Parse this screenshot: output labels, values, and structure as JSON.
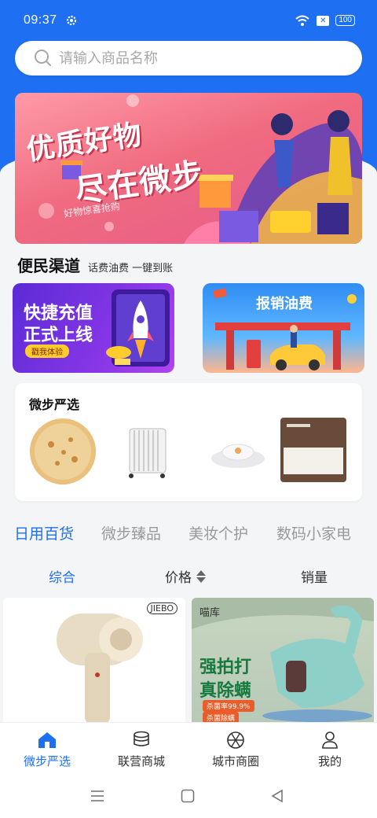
{
  "status_bar": {
    "time": "09:37",
    "battery": "100"
  },
  "search": {
    "placeholder": "请输入商品名称"
  },
  "banner": {
    "line1": "优质好物",
    "line2": "尽在微步",
    "sub": "好物惊喜抢购"
  },
  "section": {
    "title": "便民渠道",
    "subtitle": "话费油费 一键到账"
  },
  "promo_left": {
    "line1": "快捷充值",
    "line2": "正式上线",
    "pill": "戳我体验"
  },
  "promo_right": {
    "title": "报销油费"
  },
  "select_card": {
    "title": "微步严选"
  },
  "category_tabs": [
    "日用百货",
    "微步臻品",
    "美妆个护",
    "数码小家电"
  ],
  "sort_bar": {
    "comprehensive": "综合",
    "price": "价格",
    "sales": "销量"
  },
  "products": [
    {
      "brand": "JIEBO"
    },
    {
      "shop": "喵库",
      "headline1": "强拍打",
      "headline2": "真除螨",
      "tag1": "杀菌率99.9%",
      "tag2": "杀菌除螨"
    }
  ],
  "bottom_nav": [
    {
      "label": "微步严选",
      "icon": "home-icon"
    },
    {
      "label": "联营商城",
      "icon": "coins-icon"
    },
    {
      "label": "城市商圈",
      "icon": "aperture-icon"
    },
    {
      "label": "我的",
      "icon": "user-icon"
    }
  ],
  "colors": {
    "primary": "#1e6ff1",
    "background": "#f4f5f7"
  }
}
